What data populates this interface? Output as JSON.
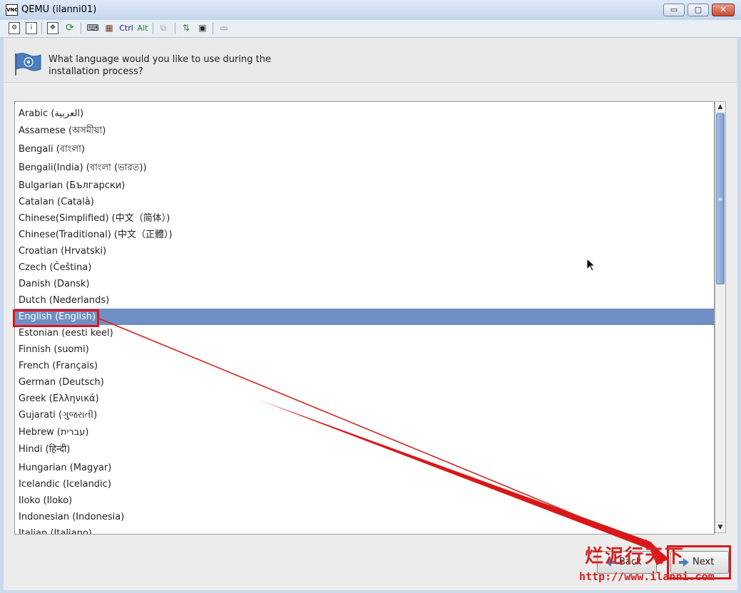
{
  "window": {
    "app_icon": "VNC",
    "title": "QEMU (ilanni01)",
    "min_glyph": "▭",
    "max_glyph": "▢",
    "close_glyph": "✕"
  },
  "toolbar": {
    "ctrl": "Ctrl",
    "alt": "Alt"
  },
  "header": {
    "prompt": "What language would you like to use during the installation process?"
  },
  "languages": [
    "Arabic (العربية)",
    "Assamese (অসমীয়া)",
    "Bengali (বাংলা)",
    "Bengali(India) (বাংলা (ভারত))",
    "Bulgarian (Български)",
    "Catalan (Català)",
    "Chinese(Simplified) (中文（简体）)",
    "Chinese(Traditional) (中文（正體）)",
    "Croatian (Hrvatski)",
    "Czech (Čeština)",
    "Danish (Dansk)",
    "Dutch (Nederlands)",
    "English (English)",
    "Estonian (eesti keel)",
    "Finnish (suomi)",
    "French (Français)",
    "German (Deutsch)",
    "Greek (Ελληνικά)",
    "Gujarati (ગુજરાતી)",
    "Hebrew (עברית)",
    "Hindi (हिन्दी)",
    "Hungarian (Magyar)",
    "Icelandic (Icelandic)",
    "Iloko (Iloko)",
    "Indonesian (Indonesia)",
    "Italian (Italiano)"
  ],
  "selected_language": "English (English)",
  "buttons": {
    "back": "Back",
    "next": "Next"
  },
  "watermark": {
    "text": "烂泥行天下",
    "url": "http://www.ilanni.com"
  },
  "colors": {
    "selection": "#6f8fc4",
    "annotation": "#d81818"
  }
}
